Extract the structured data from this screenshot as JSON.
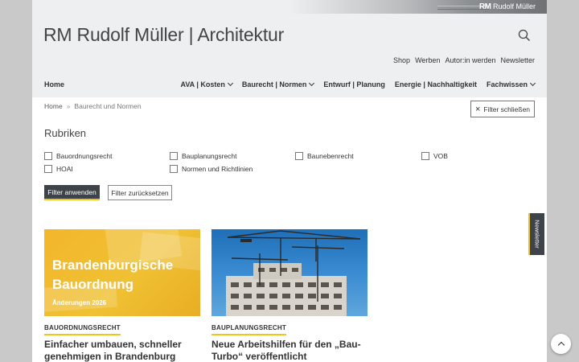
{
  "brand": {
    "logo_mark": "RM",
    "logo_text": "Rudolf Müller",
    "line_colors": [
      "#f0c419",
      "#7ab33e",
      "#d84a3a"
    ]
  },
  "header": {
    "site_title": "RM Rudolf Müller | Architektur",
    "search_icon": "search-icon"
  },
  "meta_nav": [
    "Shop",
    "Werben",
    "Autor:in werden",
    "Newsletter"
  ],
  "main_nav": {
    "home": "Home",
    "items": [
      {
        "label": "AVA | Kosten",
        "dropdown": true
      },
      {
        "label": "Baurecht | Normen",
        "dropdown": true
      },
      {
        "label": "Entwurf | Planung",
        "dropdown": false
      },
      {
        "label": "Energie | Nachhaltigkeit",
        "dropdown": false
      },
      {
        "label": "Fachwissen",
        "dropdown": true
      }
    ]
  },
  "breadcrumb": {
    "home": "Home",
    "separator": "»",
    "current": "Baurecht und Normen"
  },
  "filter": {
    "close_label": "Filter schließen",
    "close_icon": "close-icon",
    "title": "Rubriken",
    "options": [
      {
        "label": "Bauordnungsrecht",
        "checked": false
      },
      {
        "label": "Bauplanungsrecht",
        "checked": false
      },
      {
        "label": "Baunebenrecht",
        "checked": false
      },
      {
        "label": "VOB",
        "checked": false
      },
      {
        "label": "HOAI",
        "checked": false
      },
      {
        "label": "Normen und Richtlinien",
        "checked": false
      }
    ],
    "apply_label": "Filter anwenden",
    "reset_label": "Filter zurücksetzen"
  },
  "cards": [
    {
      "image_title_line1": "Brandenburgische",
      "image_title_line2": "Bauordnung",
      "image_subtitle": "Änderungen 2026",
      "category": "BAUORDNUNGSRECHT",
      "title": "Einfacher umbauen, schneller genehmigen in Brandenburg"
    },
    {
      "image_alt": "crane-photo",
      "category": "BAUPLANUNGSRECHT",
      "title": "Neue Arbeitshilfen für den „Bau-Turbo“ veröffentlicht"
    }
  ],
  "newsletter_tab": "Newsletter",
  "colors": {
    "accent": "#f0c419",
    "dark": "#3d4348",
    "header_bg": "#eeeff0"
  }
}
